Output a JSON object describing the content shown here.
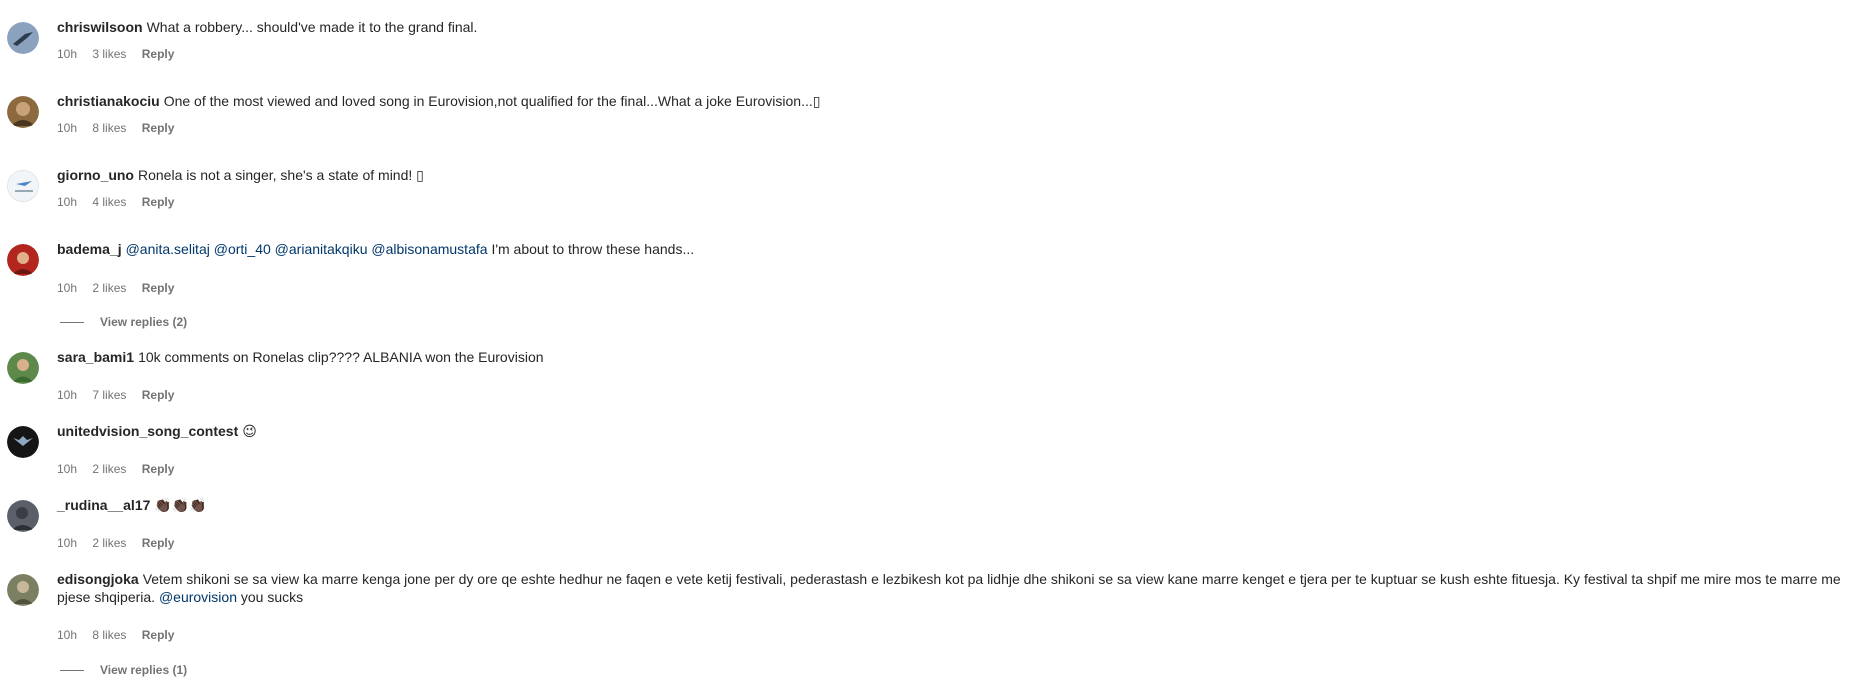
{
  "comments": [
    {
      "username": "chriswilsoon",
      "text": "What a robbery... should've made it to the grand final.",
      "time": "10h",
      "likes": "3 likes",
      "reply": "Reply",
      "avatar_color": "#8aa2bd"
    },
    {
      "username": "christianakociu",
      "text": "One of the most viewed and loved song in Eurovision,not qualified for the final...What a joke Eurovision...▯",
      "time": "10h",
      "likes": "8 likes",
      "reply": "Reply",
      "avatar_color": "#8c6a3e"
    },
    {
      "username": "giorno_uno",
      "text": "Ronela is not a singer, she's a state of mind! ▯",
      "time": "10h",
      "likes": "4 likes",
      "reply": "Reply",
      "avatar_color": "#e9eef4"
    },
    {
      "username": "badema_j",
      "mentions": [
        "@anita.selitaj",
        "@orti_40",
        "@arianitakqiku",
        "@albisonamustafa"
      ],
      "text": "I'm about to throw these hands...",
      "time": "10h",
      "likes": "2 likes",
      "reply": "Reply",
      "view_replies": "View replies (2)",
      "avatar_color": "#b3261e"
    },
    {
      "username": "sara_bami1",
      "text": "10k comments on Ronelas clip???? ALBANIA won the Eurovision",
      "time": "10h",
      "likes": "7 likes",
      "reply": "Reply",
      "avatar_color": "#5d8a4a"
    },
    {
      "username": "unitedvision_song_contest",
      "text": "😉",
      "time": "10h",
      "likes": "2 likes",
      "reply": "Reply",
      "avatar_color": "#151515"
    },
    {
      "username": "_rudina__al17",
      "text": "👏🏿👏🏿👏🏿",
      "time": "10h",
      "likes": "2 likes",
      "reply": "Reply",
      "avatar_color": "#5a5f69"
    },
    {
      "username": "edisongjoka",
      "text": "Vetem shikoni se sa view ka marre kenga jone per dy ore qe eshte hedhur ne faqen e vete ketij festivali, pederastash e lezbikesh kot pa lidhje dhe shikoni se sa view kane marre kenget e tjera per te kuptuar se kush eshte fituesja. Ky festival ta shpif me mire mos te marre me pjese shqiperia.",
      "mention_after": "@eurovision",
      "text_after": "you sucks",
      "time": "10h",
      "likes": "8 likes",
      "reply": "Reply",
      "view_replies": "View replies (1)",
      "avatar_color": "#7d7f63"
    }
  ]
}
